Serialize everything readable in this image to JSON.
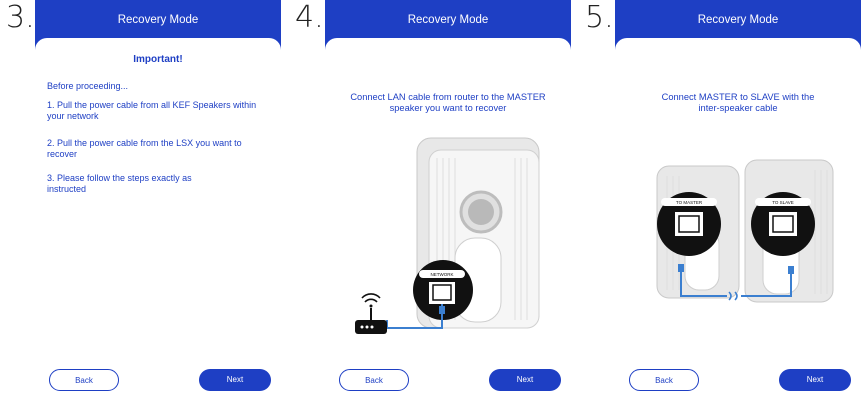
{
  "steps": [
    {
      "number": "3.",
      "title": "Recovery Mode",
      "heading": "Important!",
      "paragraphs": [
        "Before proceeding...",
        "1. Pull the power cable from all KEF Speakers within your network",
        "2. Pull the power cable from the LSX you want to recover",
        "3. Please follow the steps exactly as instructed"
      ],
      "back_label": "Back",
      "next_label": "Next"
    },
    {
      "number": "4.",
      "title": "Recovery Mode",
      "instruction": "Connect LAN cable from router to the MASTER speaker you want to recover",
      "port_label": "NETWORK",
      "back_label": "Back",
      "next_label": "Next"
    },
    {
      "number": "5.",
      "title": "Recovery Mode",
      "instruction": "Connect MASTER to SLAVE with the inter-speaker cable",
      "master_port_label": "TO MASTER",
      "slave_port_label": "TO SLAVE",
      "back_label": "Back",
      "next_label": "Next"
    }
  ],
  "colors": {
    "brand_blue": "#1e3fc4",
    "cable_blue": "#3b7fd0",
    "speaker_grey": "#dcdcdc"
  },
  "icons": [
    "wifi-icon",
    "router-icon",
    "speaker-icon",
    "ethernet-port-icon"
  ]
}
